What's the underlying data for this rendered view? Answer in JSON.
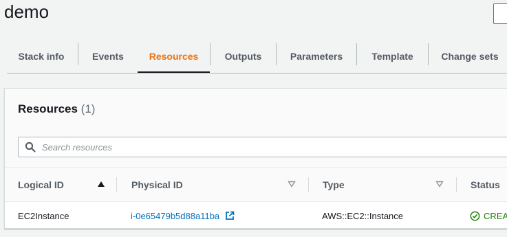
{
  "stack": {
    "name": "demo"
  },
  "tabs": [
    {
      "label": "Stack info",
      "active": false
    },
    {
      "label": "Events",
      "active": false
    },
    {
      "label": "Resources",
      "active": true
    },
    {
      "label": "Outputs",
      "active": false
    },
    {
      "label": "Parameters",
      "active": false
    },
    {
      "label": "Template",
      "active": false
    },
    {
      "label": "Change sets",
      "active": false
    }
  ],
  "resources": {
    "title": "Resources",
    "count": "(1)",
    "search": {
      "placeholder": "Search resources",
      "value": ""
    },
    "columns": [
      "Logical ID",
      "Physical ID",
      "Type",
      "Status"
    ],
    "rows": [
      {
        "logical_id": "EC2Instance",
        "physical_id": "i-0e65479b5d88a11ba",
        "type": "AWS::EC2::Instance",
        "status": "CREA"
      }
    ]
  },
  "colors": {
    "accent": "#ec7211",
    "link": "#0073bb",
    "success": "#1d8102"
  },
  "icons": [
    "search-icon",
    "sort-ascending-icon",
    "sort-descending-icon",
    "external-link-icon",
    "check-circle-icon"
  ]
}
